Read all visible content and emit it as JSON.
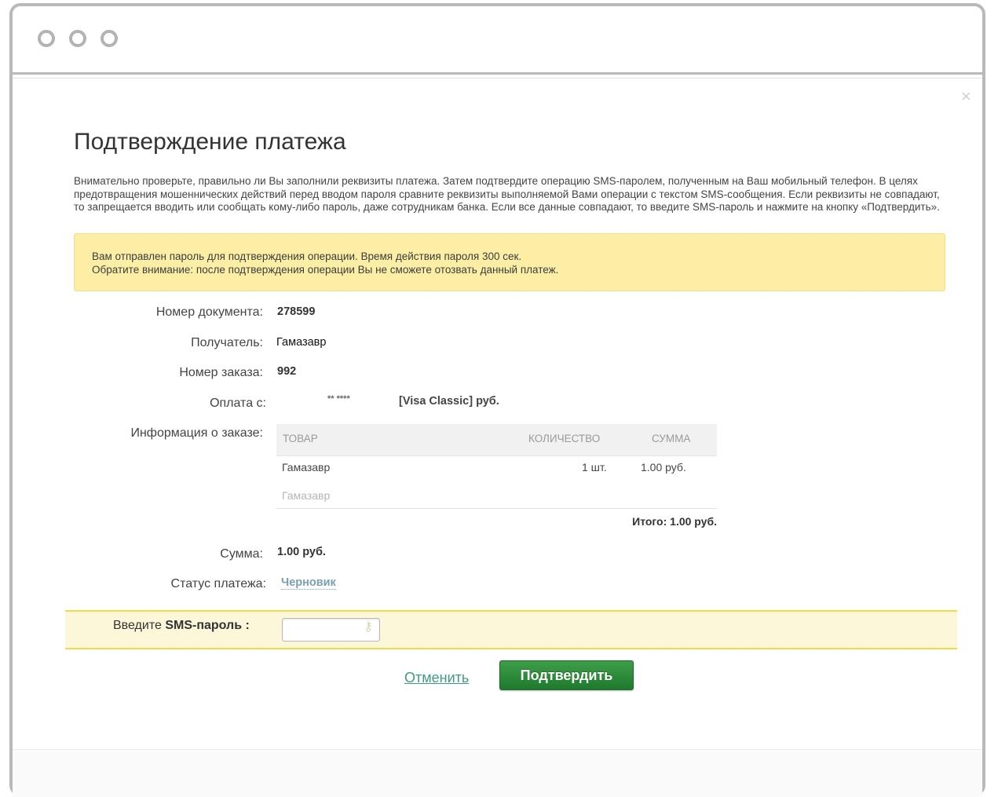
{
  "dialog": {
    "close_icon": "×",
    "title": "Подтверждение платежа",
    "intro": "Внимательно проверьте, правильно ли Вы заполнили реквизиты платежа. Затем подтвердите операцию SMS-паролем, полученным на Ваш мобильный телефон. В целях предотвращения мошеннических действий перед вводом пароля сравните реквизиты выполняемой Вами операции с текстом SMS-сообщения. Если реквизиты не совпадают, то запрещается вводить или сообщать кому-либо пароль, даже сотрудникам банка. Если все данные совпадают, то введите SMS-пароль и нажмите на кнопку «Подтвердить».",
    "notice_line1": "Вам отправлен пароль для подтверждения операции. Время действия пароля 300 сек.",
    "notice_line2": "Обратите внимание: после подтверждения операции Вы не сможете отозвать данный платеж."
  },
  "details": {
    "doc_number_label": "Номер документа:",
    "doc_number": "278599",
    "recipient_label": "Получатель:",
    "recipient": "Гамазавр",
    "order_number_label": "Номер заказа:",
    "order_number": "992",
    "payment_from_label": "Оплата с:",
    "card_mask": "** ****",
    "card_type": "[Visa Classic]  руб.",
    "order_info_label": "Информация о заказе:",
    "sum_label": "Сумма:",
    "sum": "1.00  руб.",
    "status_label": "Статус платежа:",
    "status": "Черновик"
  },
  "order_table": {
    "headers": {
      "item": "ТОВАР",
      "quantity": "КОЛИЧЕСТВО",
      "amount": "СУММА"
    },
    "rows": [
      {
        "item": "Гамазавр",
        "quantity": "1 шт.",
        "amount": "1.00  руб."
      }
    ],
    "item_description": "Гамазавр",
    "total": "Итого: 1.00 руб."
  },
  "sms": {
    "label_prefix": "Введите ",
    "label_bold": "SMS-пароль :",
    "input_value": "",
    "key_icon": "⚷"
  },
  "actions": {
    "cancel": "Отменить",
    "confirm": "Подтвердить"
  },
  "colors": {
    "notice_bg": "#fcefa5",
    "sms_bar_bg": "#fdf7da",
    "sms_bar_border": "#f2d84b",
    "confirm_button": "#2b8a39",
    "link": "#3f9a82",
    "status": "#7aa0ad"
  }
}
